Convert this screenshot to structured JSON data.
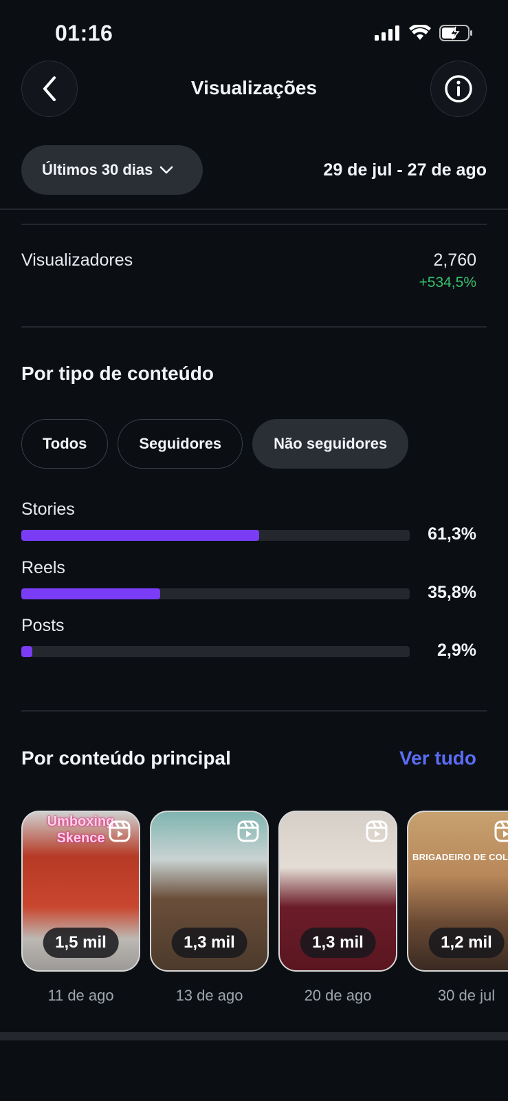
{
  "status": {
    "time": "01:16"
  },
  "header": {
    "title": "Visualizações"
  },
  "filters": {
    "range_label": "Últimos 30 dias",
    "date_range": "29 de jul - 27 de ago"
  },
  "viewers": {
    "label": "Visualizadores",
    "value": "2,760",
    "change": "+534,5%"
  },
  "content_type": {
    "title": "Por tipo de conteúdo",
    "tabs": [
      {
        "label": "Todos",
        "active": false
      },
      {
        "label": "Seguidores",
        "active": false
      },
      {
        "label": "Não seguidores",
        "active": true
      }
    ],
    "bars": [
      {
        "label": "Stories",
        "percent": 61.3,
        "percent_label": "61,3%"
      },
      {
        "label": "Reels",
        "percent": 35.8,
        "percent_label": "35,8%"
      },
      {
        "label": "Posts",
        "percent": 2.9,
        "percent_label": "2,9%"
      }
    ]
  },
  "top_content": {
    "title": "Por conteúdo principal",
    "see_all": "Ver tudo",
    "items": [
      {
        "views": "1,5 mil",
        "date": "11 de ago",
        "overlay": "Umboxing Skence"
      },
      {
        "views": "1,3 mil",
        "date": "13 de ago"
      },
      {
        "views": "1,3 mil",
        "date": "20 de ago"
      },
      {
        "views": "1,2 mil",
        "date": "30 de jul",
        "overlay": "BRIGADEIRO DE COLH"
      }
    ]
  },
  "colors": {
    "accent": "#7a3cf5",
    "link": "#5b6df5",
    "positive": "#37c16b"
  },
  "icons": {
    "back": "chevron-left-icon",
    "info": "info-icon",
    "dropdown": "chevron-down-icon",
    "reel": "reel-icon"
  }
}
